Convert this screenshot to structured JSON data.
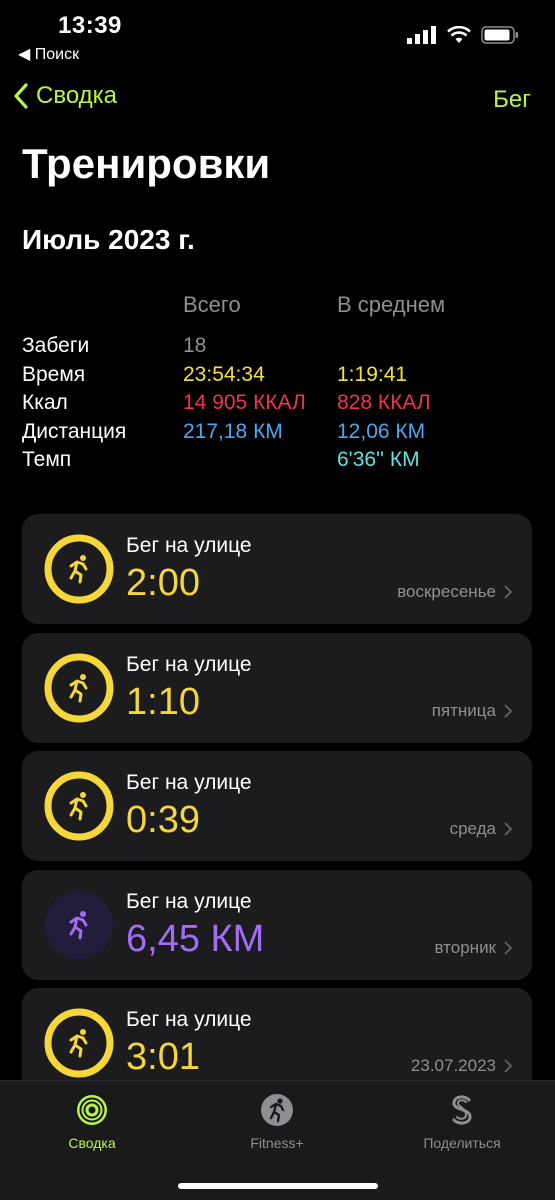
{
  "status": {
    "time": "13:39",
    "back_app": "◀ Поиск"
  },
  "nav": {
    "back_label": "Сводка",
    "right_label": "Бег"
  },
  "page_title": "Тренировки",
  "section_title": "Июль 2023 г.",
  "stats": {
    "headers": [
      "Всего",
      "В среднем"
    ],
    "rows": [
      {
        "label": "Забеги",
        "total": "18",
        "avg": ""
      },
      {
        "label": "Время",
        "total": "23:54:34",
        "avg": "1:19:41"
      },
      {
        "label": "Ккал",
        "total": "14 905 ККАЛ",
        "avg": "828 ККАЛ"
      },
      {
        "label": "Дистанция",
        "total": "217,18 КМ",
        "avg": "12,06 КМ"
      },
      {
        "label": "Темп",
        "total": "",
        "avg": "6'36'' КМ"
      }
    ],
    "colors": {
      "label": "#ffffff",
      "count": "#8e8e93",
      "time": "#f5e13b",
      "kcal": "#f0344f",
      "distance": "#4aa8f0",
      "pace": "#5fe3e0"
    }
  },
  "workouts": [
    {
      "title": "Бег на улице",
      "value": "2:00",
      "meta": "воскресенье",
      "color": "#f5d63b",
      "ring_progress": 1.0,
      "icon": "running-icon"
    },
    {
      "title": "Бег на улице",
      "value": "1:10",
      "meta": "пятница",
      "color": "#f5d63b",
      "ring_progress": 1.0,
      "icon": "running-icon"
    },
    {
      "title": "Бег на улице",
      "value": "0:39",
      "meta": "среда",
      "color": "#f5d63b",
      "ring_progress": 1.0,
      "icon": "running-icon"
    },
    {
      "title": "Бег на улице",
      "value": "6,45 КМ",
      "meta": "вторник",
      "color": "#a26cf5",
      "ring_progress": 0.0,
      "icon": "running-icon"
    },
    {
      "title": "Бег на улице",
      "value": "3:01",
      "meta": "23.07.2023",
      "color": "#f5d63b",
      "ring_progress": 1.0,
      "icon": "running-icon"
    }
  ],
  "tabs": [
    {
      "label": "Сводка",
      "icon": "activity-rings-icon",
      "active": true
    },
    {
      "label": "Fitness+",
      "icon": "fitness-plus-icon",
      "active": false
    },
    {
      "label": "Поделиться",
      "icon": "sharing-icon",
      "active": false
    }
  ],
  "accent": "#b8f54a"
}
